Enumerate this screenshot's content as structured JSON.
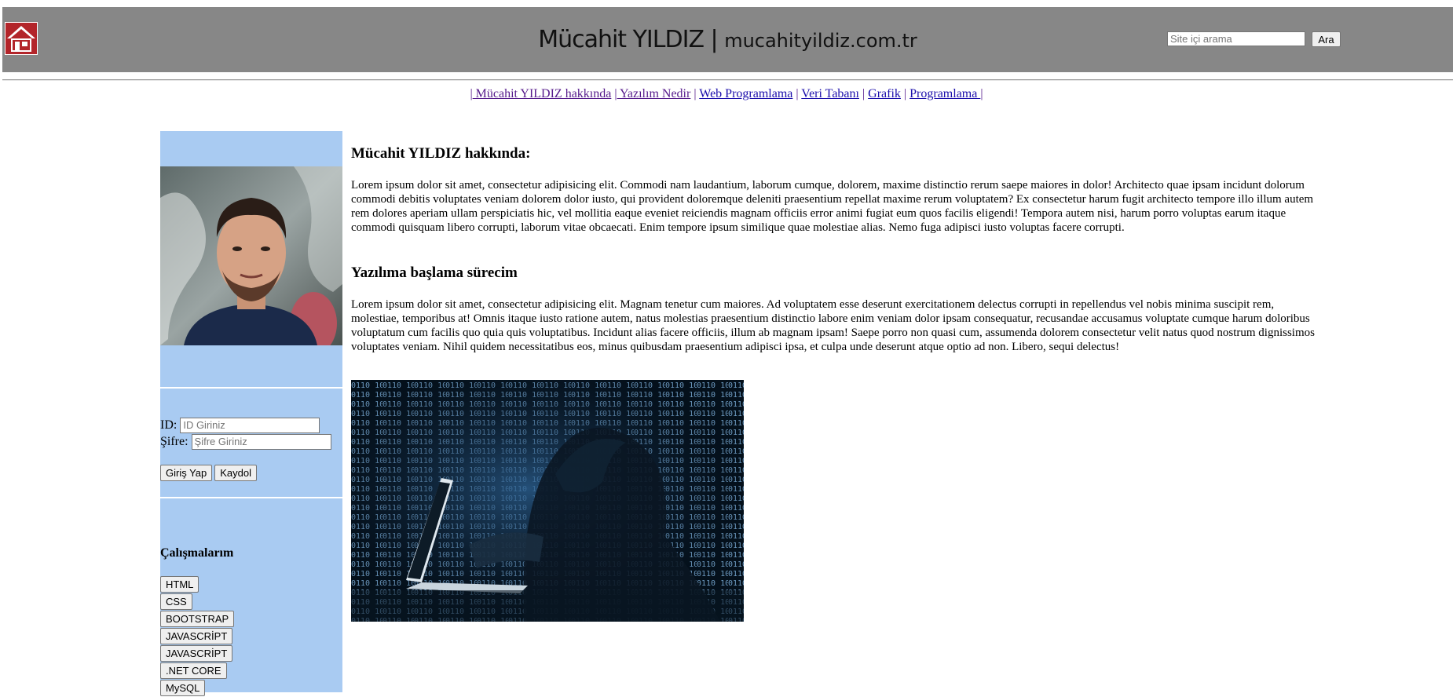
{
  "header": {
    "title": "Mücahit YILDIZ | ",
    "domain": "mucahityildiz.com.tr",
    "home_icon": "house-icon",
    "search": {
      "placeholder": "Site içi arama",
      "value": "",
      "button_label": "Ara"
    },
    "background_color": "#878787"
  },
  "nav": {
    "items": [
      {
        "label": " Mücahit YILDIZ hakkında"
      },
      {
        "label": " Yazılım Nedir"
      },
      {
        "label": "Web Programlama"
      },
      {
        "label": "Veri Tabanı"
      },
      {
        "label": "Grafik"
      },
      {
        "label": "Programlama "
      }
    ],
    "separator": "|"
  },
  "sidebar": {
    "background_color": "#a9cbf2",
    "login": {
      "id_label": "ID:",
      "id_placeholder": "ID Giriniz",
      "password_label": "Şifre:",
      "password_placeholder": "Şifre Giriniz",
      "login_button": "Giriş Yap",
      "register_button": "Kaydol"
    },
    "works": {
      "title": "Çalışmalarım",
      "items": [
        "HTML",
        "CSS",
        "BOOTSTRAP",
        "JAVASCRİPT",
        "JAVASCRİPT",
        ".NET CORE",
        "MySQL"
      ]
    }
  },
  "main": {
    "about_heading": "Mücahit YILDIZ hakkında:",
    "about_text": "Lorem ipsum dolor sit amet, consectetur adipisicing elit. Commodi nam laudantium, laborum cumque, dolorem, maxime distinctio rerum saepe maiores in dolor! Architecto quae ipsam incidunt dolorum commodi debitis voluptates veniam dolorem dolor iusto, qui provident doloremque deleniti praesentium repellat maxime rerum voluptatem? Ex consectetur harum fugit architecto tempore illo illum autem rem dolores aperiam ullam perspiciatis hic, vel mollitia eaque eveniet reiciendis magnam officiis error animi fugiat eum quos facilis eligendi! Tempora autem nisi, harum porro voluptas earum itaque commodi quisquam libero corrupti, laborum vitae obcaecati. Enim tempore ipsum similique quae molestiae alias. Nemo fuga adipisci iusto voluptas facere corrupti.",
    "start_heading": "Yazılıma başlama sürecim",
    "start_text": "Lorem ipsum dolor sit amet, consectetur adipisicing elit. Magnam tenetur cum maiores. Ad voluptatem esse deserunt exercitationem delectus corrupti in repellendus vel nobis minima suscipit rem, molestiae, temporibus at! Omnis itaque iusto ratione autem, natus molestias praesentium distinctio labore enim veniam dolor ipsam consequatur, recusandae accusamus voluptate cumque harum doloribus voluptatum cum facilis quo quia quis voluptatibus. Incidunt alias facere officiis, illum ab magnam ipsam! Saepe porro non quasi cum, assumenda dolorem consectetur velit natus quod nostrum dignissimos voluptates veniam. Nihil quidem necessitatibus eos, minus quibusdam praesentium adipisci ipsa, et culpa unde deserunt atque optio ad non. Libero, sequi delectus!"
  }
}
